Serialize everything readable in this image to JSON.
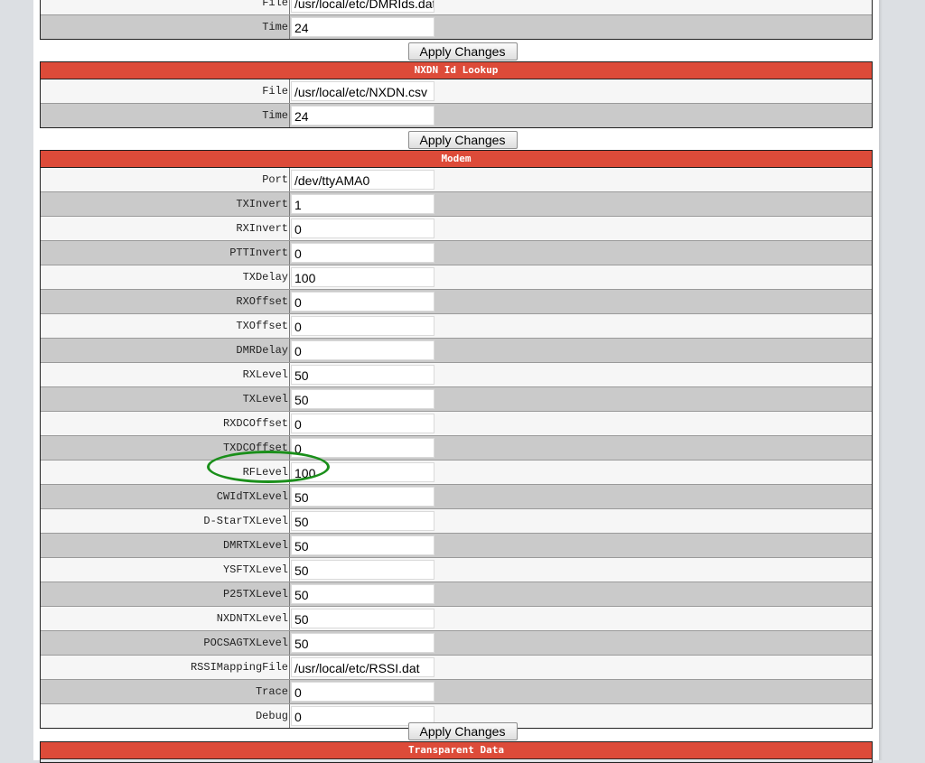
{
  "dmr_id_lookup": {
    "rows": [
      {
        "label": "File",
        "value": "/usr/local/etc/DMRIds.dat"
      },
      {
        "label": "Time",
        "value": "24"
      }
    ],
    "apply_label": "Apply Changes"
  },
  "nxdn_id_lookup": {
    "title": "NXDN Id Lookup",
    "rows": [
      {
        "label": "File",
        "value": "/usr/local/etc/NXDN.csv"
      },
      {
        "label": "Time",
        "value": "24"
      }
    ],
    "apply_label": "Apply Changes"
  },
  "modem": {
    "title": "Modem",
    "rows": [
      {
        "label": "Port",
        "value": "/dev/ttyAMA0"
      },
      {
        "label": "TXInvert",
        "value": "1"
      },
      {
        "label": "RXInvert",
        "value": "0"
      },
      {
        "label": "PTTInvert",
        "value": "0"
      },
      {
        "label": "TXDelay",
        "value": "100"
      },
      {
        "label": "RXOffset",
        "value": "0"
      },
      {
        "label": "TXOffset",
        "value": "0"
      },
      {
        "label": "DMRDelay",
        "value": "0"
      },
      {
        "label": "RXLevel",
        "value": "50"
      },
      {
        "label": "TXLevel",
        "value": "50"
      },
      {
        "label": "RXDCOffset",
        "value": "0"
      },
      {
        "label": "TXDCOffset",
        "value": "0"
      },
      {
        "label": "RFLevel",
        "value": "100"
      },
      {
        "label": "CWIdTXLevel",
        "value": "50"
      },
      {
        "label": "D-StarTXLevel",
        "value": "50"
      },
      {
        "label": "DMRTXLevel",
        "value": "50"
      },
      {
        "label": "YSFTXLevel",
        "value": "50"
      },
      {
        "label": "P25TXLevel",
        "value": "50"
      },
      {
        "label": "NXDNTXLevel",
        "value": "50"
      },
      {
        "label": "POCSAGTXLevel",
        "value": "50"
      },
      {
        "label": "RSSIMappingFile",
        "value": "/usr/local/etc/RSSI.dat"
      },
      {
        "label": "Trace",
        "value": "0"
      },
      {
        "label": "Debug",
        "value": "0"
      }
    ],
    "apply_label": "Apply Changes"
  },
  "transparent_data": {
    "title": "Transparent Data"
  },
  "colors": {
    "section_header": "#dd4b39",
    "row_dark": "#cacaca",
    "row_light": "#f6f6f6",
    "highlight": "#1a8f1a"
  }
}
